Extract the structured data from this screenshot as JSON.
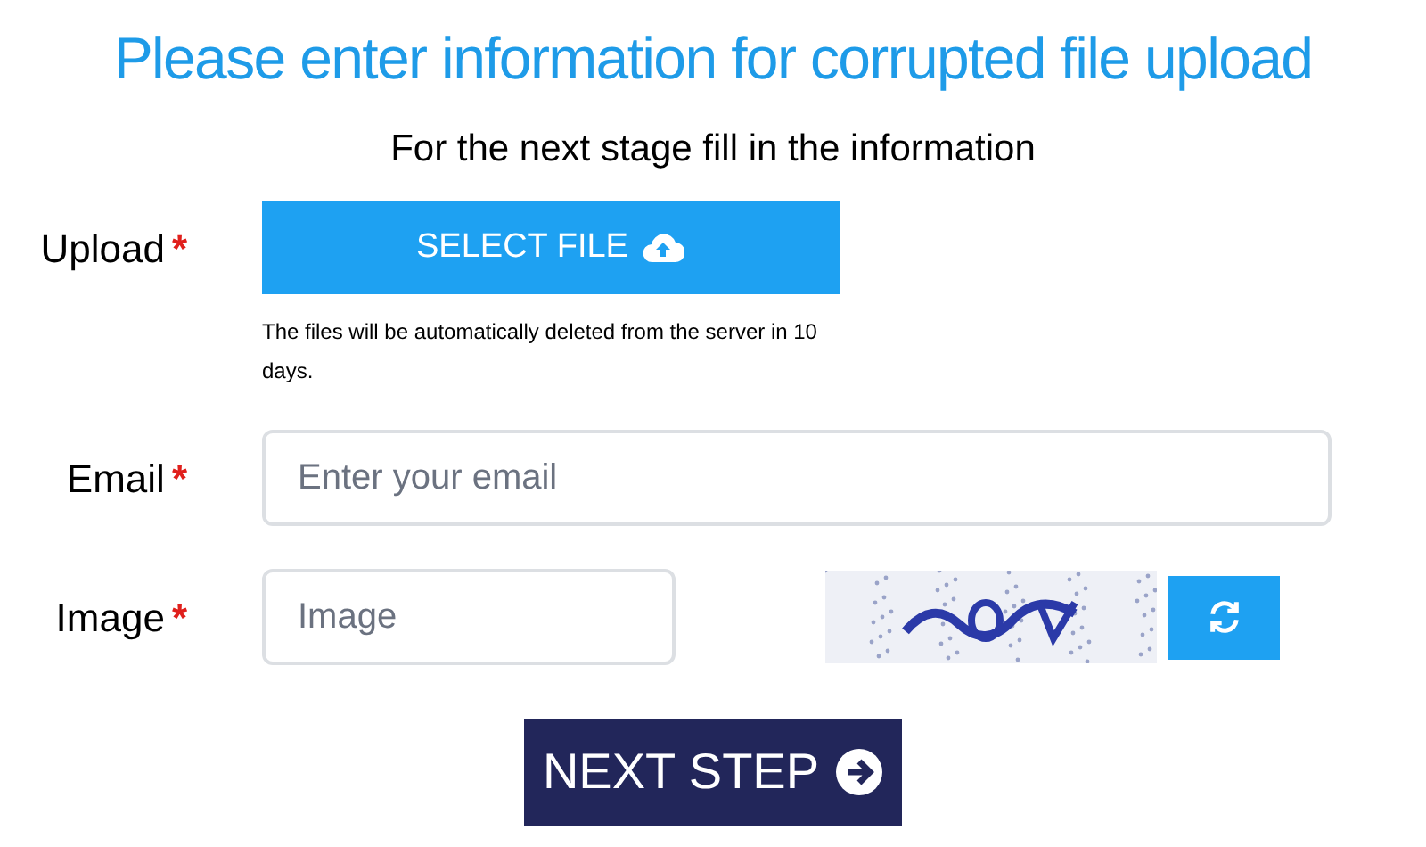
{
  "title": "Please enter information for corrupted file upload",
  "subtitle": "For the next stage fill in the information",
  "upload": {
    "label": "Upload",
    "required": "*",
    "button": "SELECT FILE",
    "note": "The files will be automatically deleted from the server in 10 days."
  },
  "email": {
    "label": "Email",
    "required": "*",
    "placeholder": "Enter your email"
  },
  "image": {
    "label": "Image",
    "required": "*",
    "placeholder": "Image"
  },
  "next_button": "NEXT STEP"
}
